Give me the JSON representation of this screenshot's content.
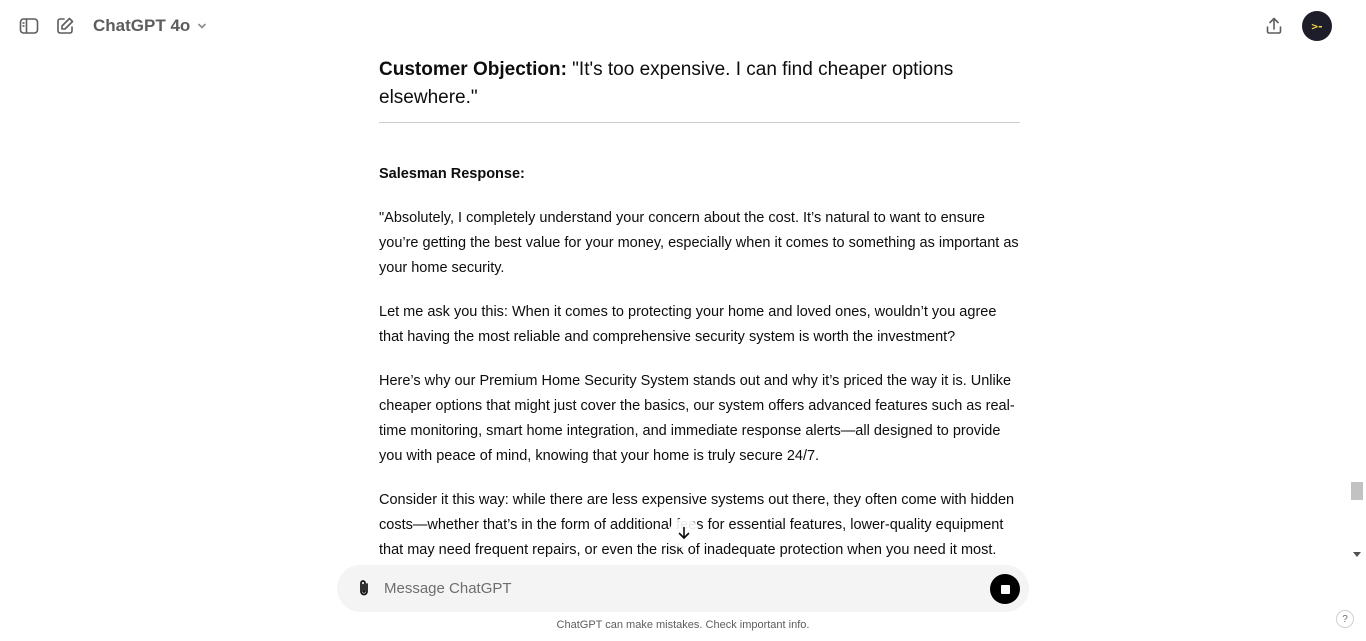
{
  "header": {
    "model_name": "ChatGPT 4o",
    "sidebar_toggle_icon": "sidebar-toggle-icon",
    "new_chat_icon": "compose-icon",
    "share_icon": "share-icon",
    "avatar_text": ">-"
  },
  "message": {
    "objection_label": "Customer Objection:",
    "objection_text": " \"It's too expensive. I can find cheaper options elsewhere.\"",
    "response_heading": "Salesman Response:",
    "paragraphs": [
      "\"Absolutely, I completely understand your concern about the cost. It’s natural to want to ensure you’re getting the best value for your money, especially when it comes to something as important as your home security.",
      "Let me ask you this: When it comes to protecting your home and loved ones, wouldn’t you agree that having the most reliable and comprehensive security system is worth the investment?",
      "Here’s why our Premium Home Security System stands out and why it’s priced the way it is. Unlike cheaper options that might just cover the basics, our system offers advanced features such as real-time monitoring, smart home integration, and immediate response alerts—all designed to provide you with peace of mind, knowing that your home is truly secure 24/7.",
      "Consider it this way: while there are less expensive systems out there, they often come with hidden costs—whether that’s in the form of additional fees for essential features, lower-quality equipment that may need frequent repairs, or even the risk of inadequate protection when you need it most."
    ]
  },
  "composer": {
    "placeholder": "Message ChatGPT",
    "value": "",
    "attach_icon": "paperclip-icon",
    "stop_icon": "stop-icon"
  },
  "footer": {
    "disclaimer": "ChatGPT can make mistakes. Check important info.",
    "help_label": "?"
  }
}
